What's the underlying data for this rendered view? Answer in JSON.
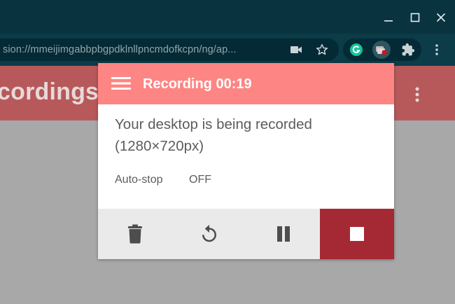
{
  "browser": {
    "url": "sion://mmeijimgabbpbgpdklnllpncmdofkcpn/ng/ap...",
    "icons": {
      "minimize": "minimize-icon",
      "maximize": "maximize-icon",
      "close": "close-icon",
      "camera": "camera-icon",
      "bookmark": "star-icon",
      "grammarly": "grammarly-icon",
      "recorder": "screen-recorder-icon",
      "extensions": "puzzle-icon",
      "menu": "vertical-dots-icon"
    }
  },
  "page": {
    "title": "cordings"
  },
  "popup": {
    "title": "Recording 00:19",
    "status_line1": "Your desktop is being recorded",
    "status_line2": "(1280×720px)",
    "autostop_label": "Auto-stop",
    "autostop_value": "OFF",
    "controls": {
      "delete": "trash-icon",
      "restart": "restart-icon",
      "pause": "pause-icon",
      "stop": "stop-icon"
    }
  },
  "colors": {
    "titlebar": "#08333f",
    "toolbar": "#0b3c48",
    "popup_header": "#fd8583",
    "page_header": "#b7595a",
    "stop_button": "#a52935",
    "grammarly": "#15c39a",
    "record_dot": "#d3131b"
  }
}
